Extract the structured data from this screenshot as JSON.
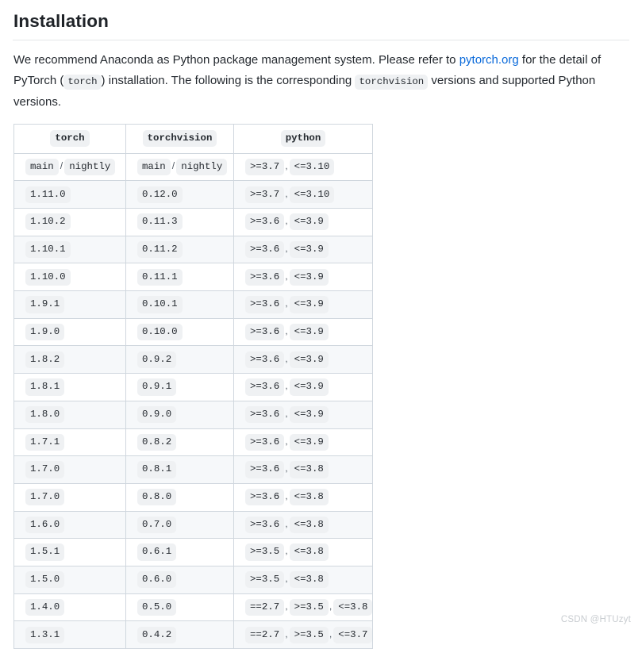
{
  "heading": "Installation",
  "intro": {
    "part1": "We recommend Anaconda as Python package management system. Please refer to ",
    "link_text": "pytorch.org",
    "part2": " for the detail of PyTorch (",
    "code1": "torch",
    "part3": ") installation. The following is the corresponding ",
    "code2": "torchvision",
    "part4": " versions and supported Python versions."
  },
  "colors": {
    "link": "#0969da",
    "code_bg": "#eff1f3",
    "border": "#d0d7de",
    "alt_row": "#f6f8fa",
    "text": "#24292f",
    "watermark": "#c8ccd0"
  },
  "table": {
    "headers": [
      "torch",
      "torchvision",
      "python"
    ],
    "rows": [
      {
        "torch": [
          "main",
          "nightly"
        ],
        "torchvision": [
          "main",
          "nightly"
        ],
        "python": [
          ">=3.7",
          "<=3.10"
        ]
      },
      {
        "torch": [
          "1.11.0"
        ],
        "torchvision": [
          "0.12.0"
        ],
        "python": [
          ">=3.7",
          "<=3.10"
        ]
      },
      {
        "torch": [
          "1.10.2"
        ],
        "torchvision": [
          "0.11.3"
        ],
        "python": [
          ">=3.6",
          "<=3.9"
        ]
      },
      {
        "torch": [
          "1.10.1"
        ],
        "torchvision": [
          "0.11.2"
        ],
        "python": [
          ">=3.6",
          "<=3.9"
        ]
      },
      {
        "torch": [
          "1.10.0"
        ],
        "torchvision": [
          "0.11.1"
        ],
        "python": [
          ">=3.6",
          "<=3.9"
        ]
      },
      {
        "torch": [
          "1.9.1"
        ],
        "torchvision": [
          "0.10.1"
        ],
        "python": [
          ">=3.6",
          "<=3.9"
        ]
      },
      {
        "torch": [
          "1.9.0"
        ],
        "torchvision": [
          "0.10.0"
        ],
        "python": [
          ">=3.6",
          "<=3.9"
        ]
      },
      {
        "torch": [
          "1.8.2"
        ],
        "torchvision": [
          "0.9.2"
        ],
        "python": [
          ">=3.6",
          "<=3.9"
        ]
      },
      {
        "torch": [
          "1.8.1"
        ],
        "torchvision": [
          "0.9.1"
        ],
        "python": [
          ">=3.6",
          "<=3.9"
        ]
      },
      {
        "torch": [
          "1.8.0"
        ],
        "torchvision": [
          "0.9.0"
        ],
        "python": [
          ">=3.6",
          "<=3.9"
        ]
      },
      {
        "torch": [
          "1.7.1"
        ],
        "torchvision": [
          "0.8.2"
        ],
        "python": [
          ">=3.6",
          "<=3.9"
        ]
      },
      {
        "torch": [
          "1.7.0"
        ],
        "torchvision": [
          "0.8.1"
        ],
        "python": [
          ">=3.6",
          "<=3.8"
        ]
      },
      {
        "torch": [
          "1.7.0"
        ],
        "torchvision": [
          "0.8.0"
        ],
        "python": [
          ">=3.6",
          "<=3.8"
        ]
      },
      {
        "torch": [
          "1.6.0"
        ],
        "torchvision": [
          "0.7.0"
        ],
        "python": [
          ">=3.6",
          "<=3.8"
        ]
      },
      {
        "torch": [
          "1.5.1"
        ],
        "torchvision": [
          "0.6.1"
        ],
        "python": [
          ">=3.5",
          "<=3.8"
        ]
      },
      {
        "torch": [
          "1.5.0"
        ],
        "torchvision": [
          "0.6.0"
        ],
        "python": [
          ">=3.5",
          "<=3.8"
        ]
      },
      {
        "torch": [
          "1.4.0"
        ],
        "torchvision": [
          "0.5.0"
        ],
        "python": [
          "==2.7",
          ">=3.5",
          "<=3.8"
        ]
      },
      {
        "torch": [
          "1.3.1"
        ],
        "torchvision": [
          "0.4.2"
        ],
        "python": [
          "==2.7",
          ">=3.5",
          "<=3.7"
        ]
      }
    ]
  },
  "watermark": "CSDN @HTUzyt"
}
